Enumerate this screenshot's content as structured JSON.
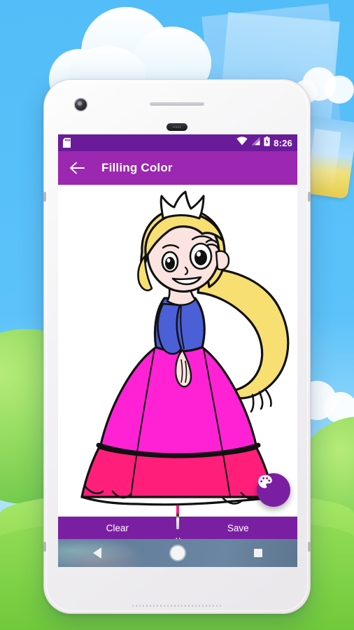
{
  "app": {
    "title": "Filling Color",
    "accent_purple": "#9c27b0",
    "statusbar_purple": "#6a1b9a",
    "button_purple": "#7b1fa2",
    "fab_purple": "#7b1fa2",
    "screen_background": "#ffffff"
  },
  "statusbar": {
    "sd_card_icon": "sd-card-icon",
    "wifi_icon": "wifi-icon",
    "signal_icon": "cellular-signal-icon",
    "battery_icon": "battery-charging-icon",
    "time": "8:26"
  },
  "appbar": {
    "back_icon": "arrow-left-icon",
    "title": "Filling Color"
  },
  "canvas": {
    "artwork_name": "princess-coloring-illustration",
    "colors": {
      "hair": "#f7df72",
      "skin": "#fbe4e0",
      "bodice": "#4b5fd6",
      "skirt_upper": "#ff22d4",
      "skirt_lower": "#ff1f7a",
      "outline": "#111111",
      "crown": "#ffffff"
    }
  },
  "fab": {
    "icon": "palette-icon",
    "label": "Color palette"
  },
  "bottom_buttons": {
    "clear_label": "Clear",
    "save_label": "Save"
  },
  "navbar": {
    "back_icon": "nav-back-triangle-icon",
    "home_icon": "nav-home-circle-icon",
    "recents_icon": "nav-recents-square-icon"
  },
  "background_scene": {
    "sky_color": "#52bdf8",
    "ground_color": "#8ed94f",
    "cloud_color": "#ffffff",
    "rainbow_colors": [
      "#e8262a",
      "#f79520",
      "#f7e32a",
      "#4cbb45",
      "#34a5e8"
    ],
    "elements": [
      "cloud-large",
      "cloud-small-top-right",
      "cloud-small-bottom-right",
      "paper-sheet-blue",
      "paper-sheet-blue-yellow",
      "hill-left",
      "hill-right",
      "rainbow-arc",
      "green-ground"
    ]
  },
  "phone": {
    "body_color": "#f3f2f4",
    "camera_icon": "front-camera-icon",
    "earpiece_icon": "earpiece-speaker-icon",
    "sensor_icon": "proximity-sensor-icon",
    "bottom_speaker_icon": "bottom-speaker-grille-icon"
  }
}
